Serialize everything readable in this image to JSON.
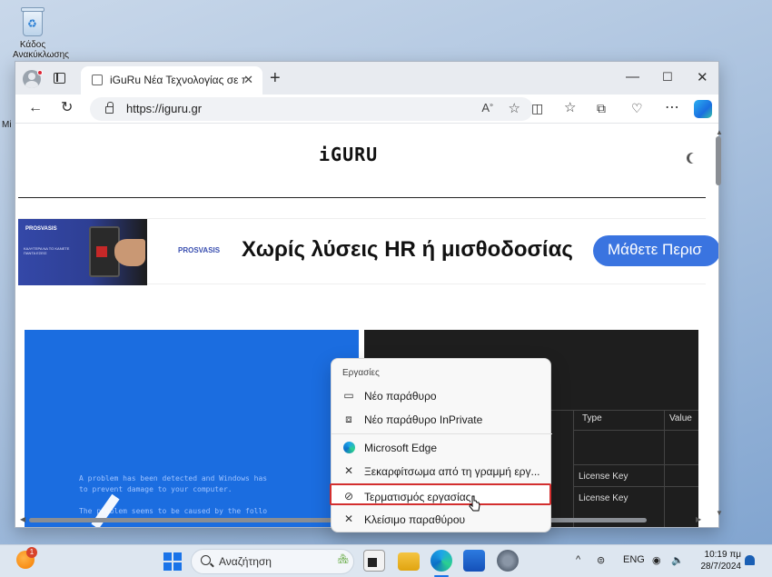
{
  "desktop": {
    "recycle_bin_label_line1": "Κάδος",
    "recycle_bin_label_line2": "Ανακύκλωσης",
    "left_edge_text": "Mi"
  },
  "browser": {
    "tab_title": "iGuRu Νέα Τεχνολογίας σε πραγμ",
    "new_tab_symbol": "+",
    "url": "https://iguru.gr",
    "window_controls": [
      "—",
      "☐",
      "✕"
    ]
  },
  "page": {
    "logo_text": "iGURU",
    "banner": {
      "brand": "PROSVASIS",
      "small_text": "ΚΑΛΥΤΕΡΑ ΝΑ ΤΟ ΚΑΝΕΤΕ ΠΑΝΤΑ ΕΣΕΙΣ",
      "logo": "PROSVASIS",
      "headline": "Χωρίς λύσεις HR ή μισθοδοσίας",
      "button": "Μάθετε Περισ"
    },
    "bsod_text": "A problem has been detected and Windows has\nto prevent damage to your computer.\n\nThe problem seems to be caused by the follo",
    "registry": {
      "col_type": "Type",
      "col_value": "Value",
      "rows": [
        "License Key",
        "License Key"
      ]
    }
  },
  "jump_list": {
    "header": "Εργασίες",
    "items": [
      {
        "label": "Νέο παράθυρο",
        "icon": "window-icon"
      },
      {
        "label": "Νέο παράθυρο InPrivate",
        "icon": "inprivate-window-icon"
      },
      {
        "label": "Microsoft Edge",
        "icon": "edge-icon"
      },
      {
        "label": "Ξεκαρφίτσωμα από τη γραμμή εργ...",
        "icon": "unpin-icon"
      },
      {
        "label": "Τερματισμός εργασίας",
        "icon": "end-task-icon"
      },
      {
        "label": "Κλείσιμο παραθύρου",
        "icon": "close-icon"
      }
    ]
  },
  "taskbar": {
    "weather_badge": "1",
    "search_placeholder": "Αναζήτηση",
    "language": "ENG",
    "time": "10:19 πμ",
    "date": "28/7/2024"
  },
  "colors": {
    "accent": "#1a73e8",
    "highlight_border": "#d32f2f",
    "banner_button": "#3a74e0"
  }
}
